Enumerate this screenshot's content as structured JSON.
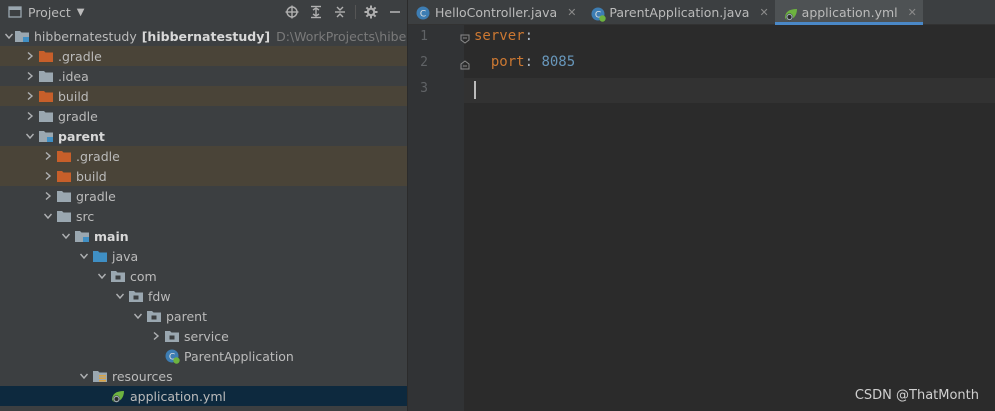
{
  "project_panel": {
    "title": "Project",
    "tools": [
      "locate-icon",
      "expand-all-icon",
      "collapse-all-icon",
      "gear-icon",
      "hide-icon"
    ]
  },
  "tree": [
    {
      "depth": 0,
      "expanded": true,
      "arrow": true,
      "icon": "module",
      "label": "hibbernatestudy",
      "suffix": "[hibbernatestudy]",
      "path": "D:\\WorkProjects\\hibernate",
      "bold": false
    },
    {
      "depth": 1,
      "expanded": false,
      "arrow": true,
      "icon": "folder-excluded",
      "label": ".gradle",
      "excluded": true
    },
    {
      "depth": 1,
      "expanded": false,
      "arrow": true,
      "icon": "folder",
      "label": ".idea"
    },
    {
      "depth": 1,
      "expanded": false,
      "arrow": true,
      "icon": "folder-excluded",
      "label": "build",
      "excluded": true
    },
    {
      "depth": 1,
      "expanded": false,
      "arrow": true,
      "icon": "folder",
      "label": "gradle"
    },
    {
      "depth": 1,
      "expanded": true,
      "arrow": true,
      "icon": "module",
      "label": "parent",
      "bold": true
    },
    {
      "depth": 2,
      "expanded": false,
      "arrow": true,
      "icon": "folder-excluded",
      "label": ".gradle",
      "excluded": true
    },
    {
      "depth": 2,
      "expanded": false,
      "arrow": true,
      "icon": "folder-excluded",
      "label": "build",
      "excluded": true
    },
    {
      "depth": 2,
      "expanded": false,
      "arrow": true,
      "icon": "folder",
      "label": "gradle"
    },
    {
      "depth": 2,
      "expanded": true,
      "arrow": true,
      "icon": "folder",
      "label": "src"
    },
    {
      "depth": 3,
      "expanded": true,
      "arrow": true,
      "icon": "module",
      "label": "main",
      "bold": true
    },
    {
      "depth": 4,
      "expanded": true,
      "arrow": true,
      "icon": "folder-source",
      "label": "java"
    },
    {
      "depth": 5,
      "expanded": true,
      "arrow": true,
      "icon": "package",
      "label": "com"
    },
    {
      "depth": 6,
      "expanded": true,
      "arrow": true,
      "icon": "package",
      "label": "fdw"
    },
    {
      "depth": 7,
      "expanded": true,
      "arrow": true,
      "icon": "package",
      "label": "parent"
    },
    {
      "depth": 8,
      "expanded": false,
      "arrow": true,
      "icon": "package",
      "label": "service"
    },
    {
      "depth": 8,
      "expanded": false,
      "arrow": false,
      "icon": "spring-class",
      "label": "ParentApplication"
    },
    {
      "depth": 4,
      "expanded": true,
      "arrow": true,
      "icon": "folder-resources",
      "label": "resources"
    },
    {
      "depth": 5,
      "expanded": false,
      "arrow": false,
      "icon": "spring-yml",
      "label": "application.yml",
      "selected": true
    }
  ],
  "tabs": [
    {
      "label": "HelloController.java",
      "icon": "class",
      "active": false
    },
    {
      "label": "ParentApplication.java",
      "icon": "spring-class",
      "active": false
    },
    {
      "label": "application.yml",
      "icon": "spring-yml",
      "active": true
    }
  ],
  "editor": {
    "line_numbers": [
      "1",
      "2",
      "3"
    ],
    "line1_key": "server",
    "line2_key": "port",
    "line2_value": "8085",
    "colon": ":"
  },
  "colors": {
    "yaml_key": "#cc7832",
    "yaml_number": "#6897bb",
    "excluded_folder": "#c75f2a",
    "folder": "#9aa7b0",
    "source_folder": "#3f8fc4",
    "selection": "#0d293e"
  },
  "watermark": "CSDN @ThatMonth"
}
